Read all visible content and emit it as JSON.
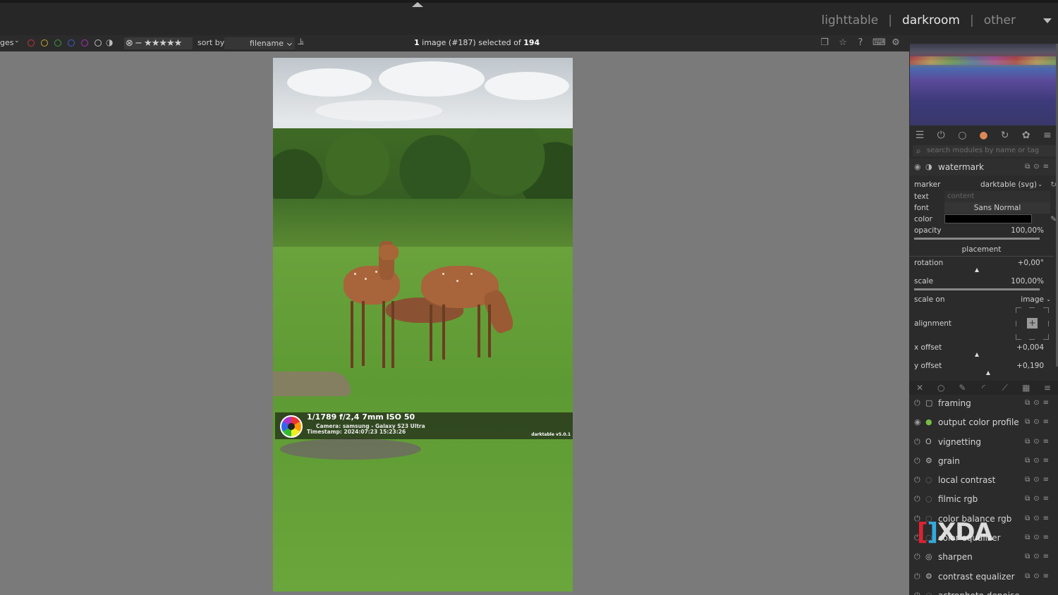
{
  "views": {
    "items": [
      "lighttable",
      "darkroom",
      "other"
    ],
    "active": "darkroom"
  },
  "filterbar": {
    "left_fragment": "ges",
    "sort_label": "sort by",
    "sort_value": "filename",
    "selection_count": "1",
    "selection_text": "image (#187) selected of",
    "selection_num": "#187",
    "selection_total": "194"
  },
  "overlay": {
    "exif": "1/1789 f/2,4 7mm ISO 50",
    "camera": "Camera: samsung - Galaxy S23 Ultra",
    "timestamp": "Timestamp: 2024:07:23 15:23:26",
    "version": "darktable v5.0.1"
  },
  "search": {
    "placeholder": "search modules by name or tag"
  },
  "watermark_module": {
    "name": "watermark",
    "marker_label": "marker",
    "marker_value": "darktable (svg)",
    "text_label": "text",
    "text_placeholder": "content",
    "font_label": "font",
    "font_value": "Sans Normal",
    "color_label": "color",
    "color_value": "#000000",
    "opacity_label": "opacity",
    "opacity_value": "100,00%",
    "placement_label": "placement",
    "rotation_label": "rotation",
    "rotation_value": "+0,00°",
    "scale_label": "scale",
    "scale_value": "100,00%",
    "scale_on_label": "scale on",
    "scale_on_value": "image",
    "alignment_label": "alignment",
    "x_offset_label": "x offset",
    "x_offset_value": "+0,004",
    "y_offset_label": "y offset",
    "y_offset_value": "+0,190"
  },
  "modules": [
    {
      "name": "framing",
      "icon": "frame-icon"
    },
    {
      "name": "output color profile",
      "icon": "color-profile-icon"
    },
    {
      "name": "vignetting",
      "icon": "vignette-icon"
    },
    {
      "name": "grain",
      "icon": "grain-icon"
    },
    {
      "name": "local contrast",
      "icon": "circle-icon"
    },
    {
      "name": "filmic rgb",
      "icon": "circle-icon"
    },
    {
      "name": "color balance rgb",
      "icon": "circle-icon"
    },
    {
      "name": "color equalizer",
      "icon": "circle-icon"
    },
    {
      "name": "sharpen",
      "icon": "sharpen-icon"
    },
    {
      "name": "contrast equalizer",
      "icon": "equalizer-icon"
    },
    {
      "name": "astrophoto denoise",
      "icon": "circle-icon"
    }
  ],
  "watermark_badge": "XDA"
}
